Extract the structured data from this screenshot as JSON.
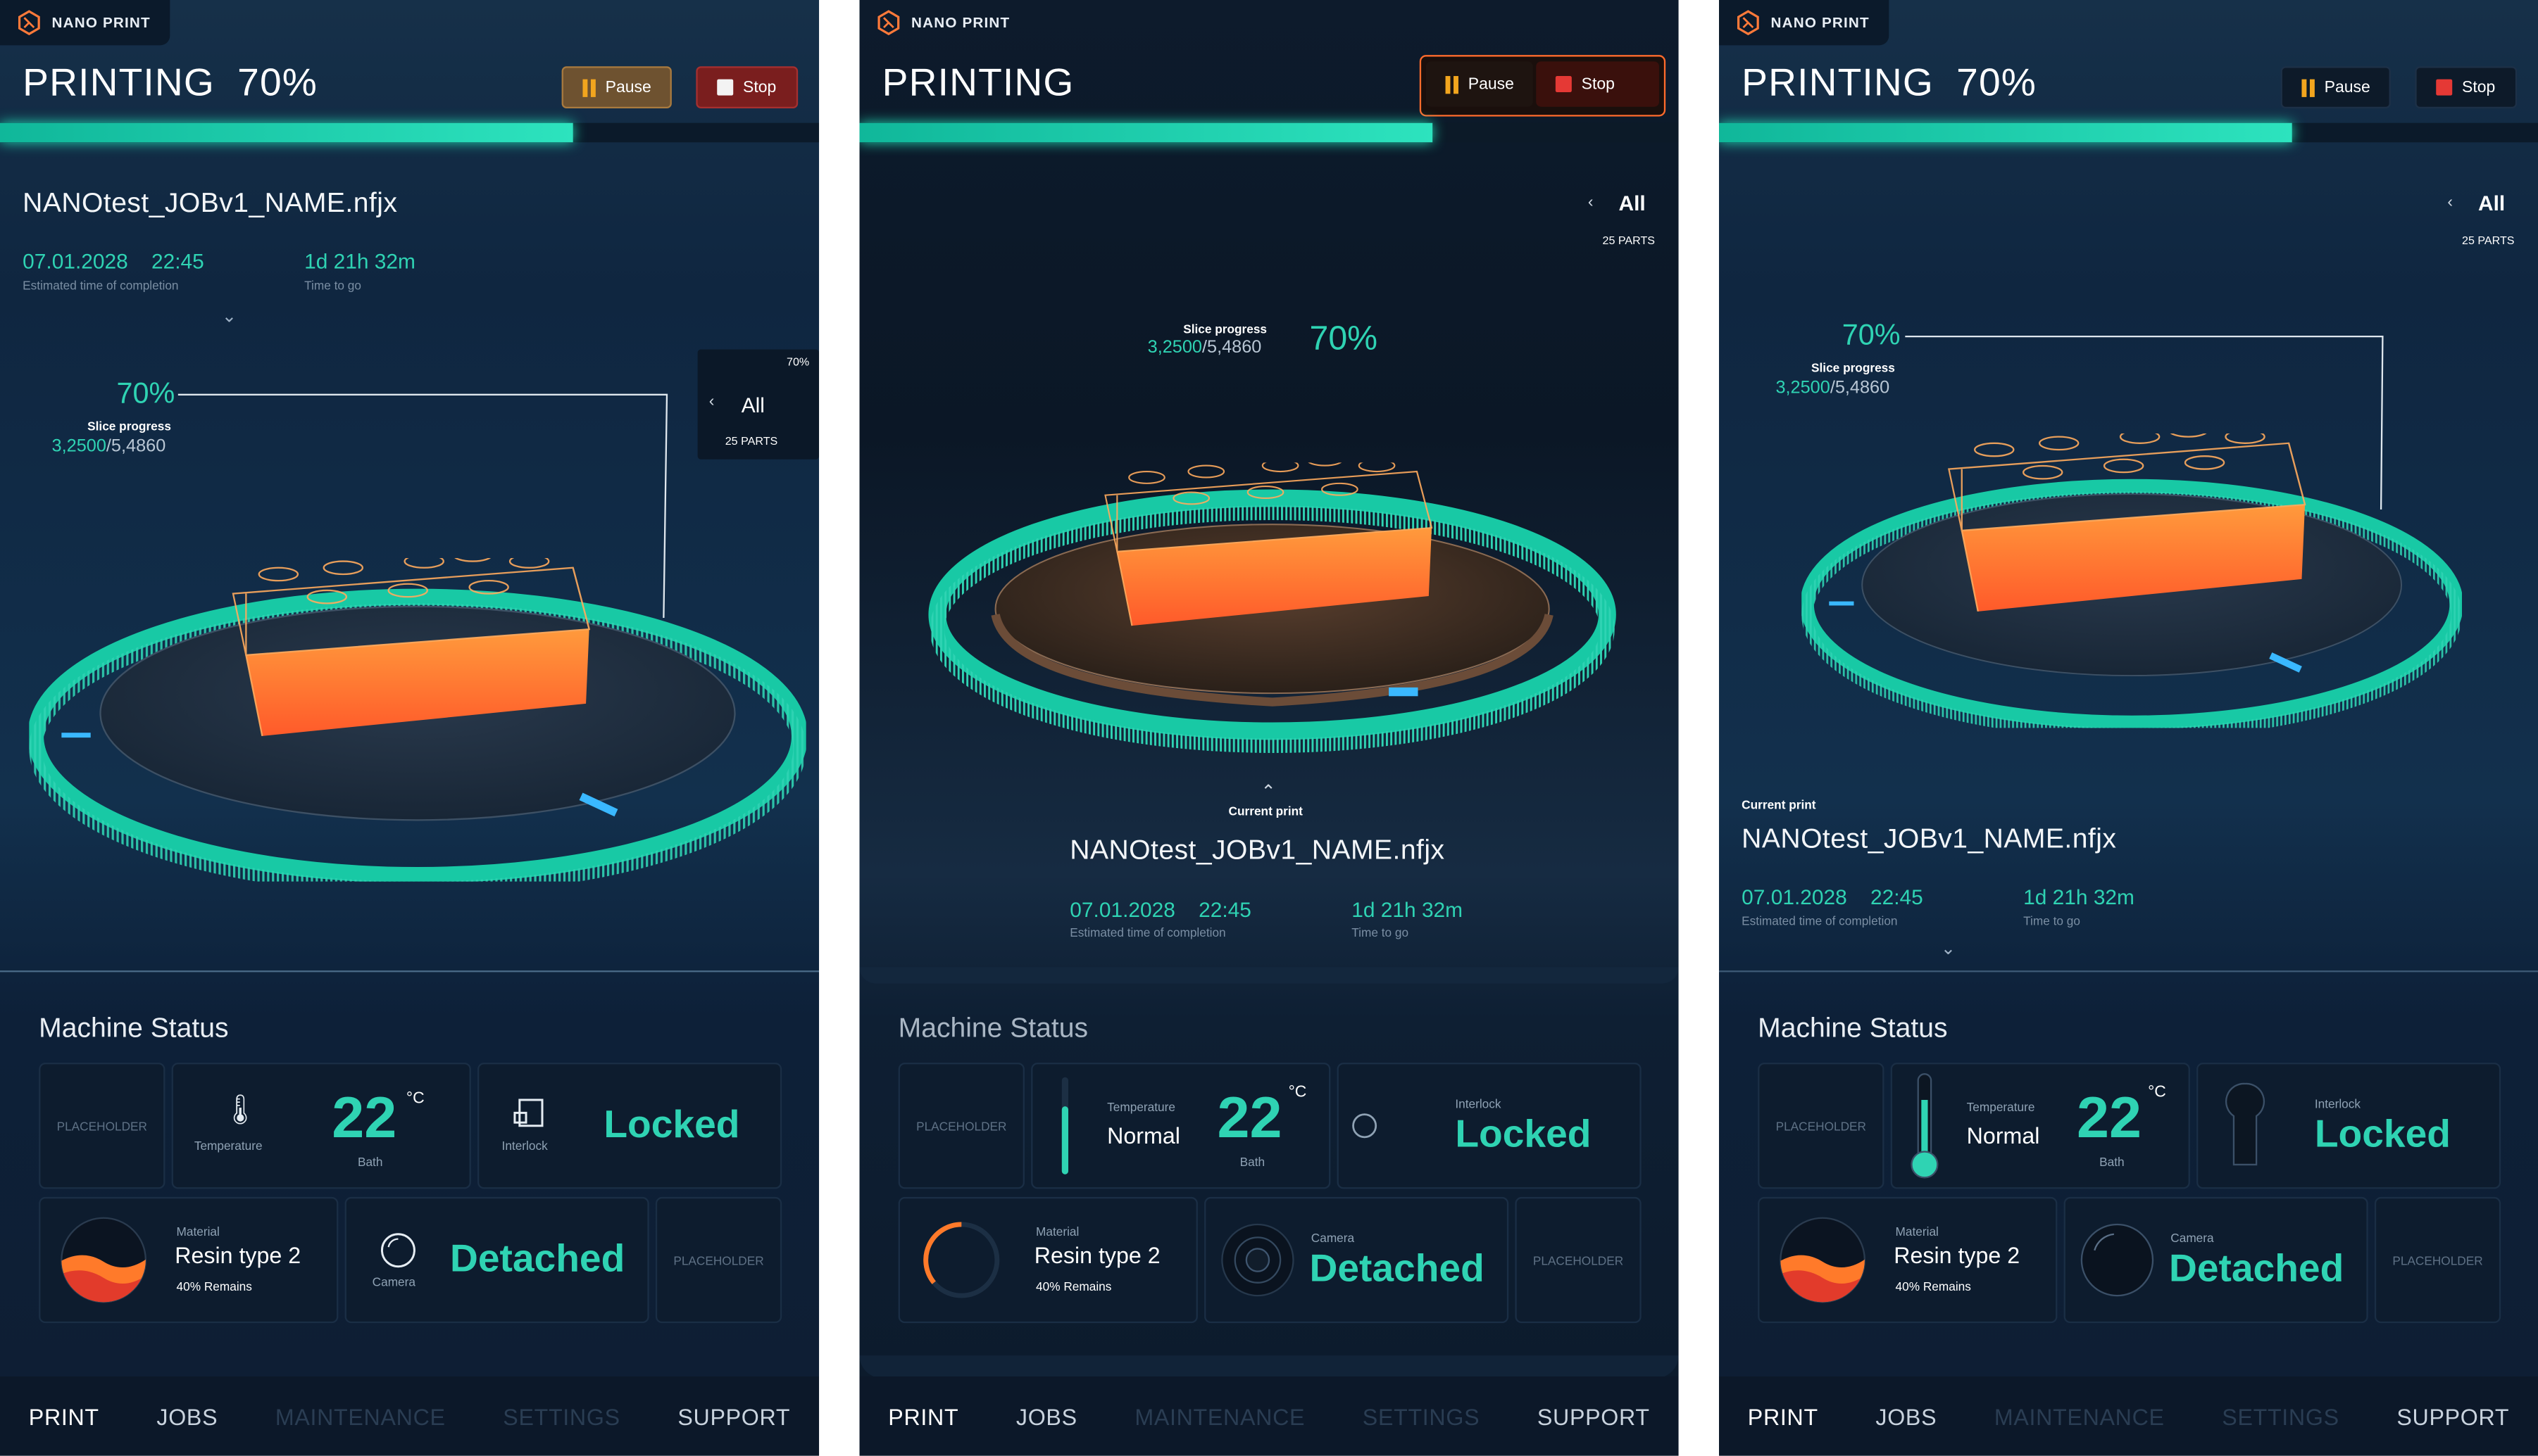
{
  "app": {
    "name": "NANO PRINT"
  },
  "colors": {
    "accent": "#2fd3b3",
    "pause": "#f2a51e",
    "stop": "#e53935",
    "model": "#ff7a3a"
  },
  "header": {
    "status": "PRINTING",
    "percent": "70%",
    "pause_label": "Pause",
    "stop_label": "Stop",
    "progress_fraction": 0.7
  },
  "job": {
    "file_name": "NANOtest_JOBv1_NAME.nfjx",
    "current_print_label": "Current print",
    "date": "07.01.2028",
    "time": "22:45",
    "completion_label": "Estimated time of completion",
    "time_to_go": "1d 21h 32m",
    "time_to_go_label": "Time to go"
  },
  "slice": {
    "percent": "70%",
    "label": "Slice progress",
    "current": "3,2500",
    "total": "/5,4860"
  },
  "parts": {
    "all_label": "All",
    "count_label": "25 PARTS",
    "percent": "70%"
  },
  "machine_status": {
    "title": "Machine Status",
    "placeholder": "PLACEHOLDER",
    "temperature": {
      "label": "Temperature",
      "value": "22",
      "unit": "°C",
      "sub": "Bath",
      "state": "Normal"
    },
    "interlock": {
      "label": "Interlock",
      "state": "Locked"
    },
    "material": {
      "label": "Material",
      "name": "Resin type 2",
      "remains": "40% Remains"
    },
    "camera": {
      "label": "Camera",
      "state": "Detached"
    }
  },
  "nav": {
    "print": "PRINT",
    "jobs": "JOBS",
    "maintenance": "MAINTENANCE",
    "settings": "SETTINGS",
    "support": "SUPPORT"
  }
}
